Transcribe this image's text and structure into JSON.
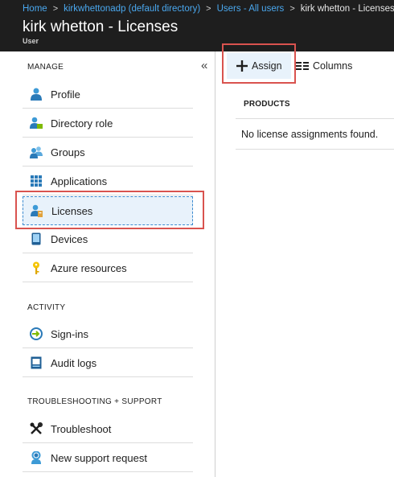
{
  "breadcrumb": {
    "items": [
      "Home",
      "kirkwhettonadp (default directory)",
      "Users - All users"
    ],
    "current": "kirk whetton - Licenses"
  },
  "header": {
    "title": "kirk whetton - Licenses",
    "subtitle": "User"
  },
  "sidebar": {
    "collapse": "«",
    "sections": [
      {
        "label": "MANAGE"
      },
      {
        "label": "ACTIVITY"
      },
      {
        "label": "TROUBLESHOOTING + SUPPORT"
      }
    ],
    "items": [
      {
        "label": "Profile",
        "icon": "user-icon"
      },
      {
        "label": "Directory role",
        "icon": "directory-role-icon"
      },
      {
        "label": "Groups",
        "icon": "groups-icon"
      },
      {
        "label": "Applications",
        "icon": "applications-grid-icon"
      },
      {
        "label": "Licenses",
        "icon": "licenses-icon",
        "selected": true
      },
      {
        "label": "Devices",
        "icon": "device-icon"
      },
      {
        "label": "Azure resources",
        "icon": "key-icon"
      },
      {
        "label": "Sign-ins",
        "icon": "sign-in-icon"
      },
      {
        "label": "Audit logs",
        "icon": "audit-log-icon"
      },
      {
        "label": "Troubleshoot",
        "icon": "wrench-icon"
      },
      {
        "label": "New support request",
        "icon": "support-icon"
      }
    ]
  },
  "toolbar": {
    "assign_label": "Assign",
    "columns_label": "Columns"
  },
  "table": {
    "header": "PRODUCTS",
    "empty_message": "No license assignments found."
  },
  "colors": {
    "header_bg": "#1e1e1e",
    "link": "#4aa8ef",
    "highlight": "#d9534f",
    "selected_bg": "#e8f2fb",
    "icon_blue": "#2a7ab8"
  }
}
